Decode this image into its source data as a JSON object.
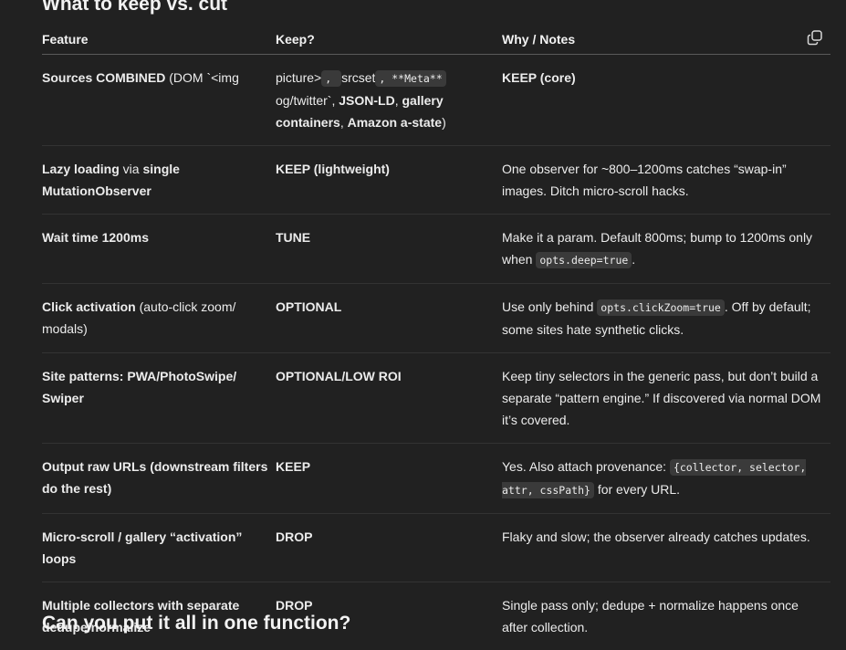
{
  "heading": "What to keep vs. cut",
  "next_heading": "Can you put it all in one function?",
  "table": {
    "headers": {
      "feature": "Feature",
      "keep": "Keep?",
      "why": "Why / Notes"
    },
    "rows": [
      {
        "feature": {
          "b1": "Sources COMBINED",
          "t1": " (DOM `<img"
        },
        "keep": {
          "t1": "picture>",
          "c1": ", ",
          "t2": "srcset",
          "c2": ", **Meta**",
          "t3": " og/twitter`, ",
          "b1": "JSON-LD",
          "t4": ", ",
          "b2": "gallery containers",
          "t5": ", ",
          "b3": "Amazon a-state",
          "t6": ")"
        },
        "why": {
          "b1": "KEEP (core)"
        }
      },
      {
        "feature": {
          "b1": "Lazy loading",
          "t1": " via ",
          "b2": "single MutationObserver"
        },
        "keep": {
          "b1": "KEEP (lightweight)"
        },
        "why": {
          "t1": "One observer for ~800–1200ms catches “swap-in” images. Ditch micro-scroll hacks."
        }
      },
      {
        "feature": {
          "b1": "Wait time 1200ms"
        },
        "keep": {
          "b1": "TUNE"
        },
        "why": {
          "t1": "Make it a param. Default 800ms; bump to 1200ms only when ",
          "c1": "opts.deep=true",
          "t2": "."
        }
      },
      {
        "feature": {
          "b1": "Click activation",
          "t1": " (auto-click zoom/ modals)"
        },
        "keep": {
          "b1": "OPTIONAL"
        },
        "why": {
          "t1": "Use only behind ",
          "c1": "opts.clickZoom=true",
          "t2": ". Off by default; some sites hate synthetic clicks."
        }
      },
      {
        "feature": {
          "b1": "Site patterns: PWA/PhotoSwipe/ Swiper"
        },
        "keep": {
          "b1": "OPTIONAL/LOW ROI"
        },
        "why": {
          "t1": "Keep tiny selectors in the generic pass, but don’t build a separate “pattern engine.” If discovered via normal DOM it’s covered."
        }
      },
      {
        "feature": {
          "b1": "Output raw URLs (downstream filters do the rest)"
        },
        "keep": {
          "b1": "KEEP"
        },
        "why": {
          "t1": "Yes. Also attach provenance: ",
          "c1": "{collector, selector, attr, cssPath}",
          "t2": " for every URL."
        }
      },
      {
        "feature": {
          "b1": "Micro-scroll / gallery “activation” loops"
        },
        "keep": {
          "b1": "DROP"
        },
        "why": {
          "t1": "Flaky and slow; the observer already catches updates."
        }
      },
      {
        "feature": {
          "b1": "Multiple collectors with separate dedupe/normalize"
        },
        "keep": {
          "b1": "DROP"
        },
        "why": {
          "t1": "Single pass only; dedupe + normalize happens once after collection."
        }
      }
    ]
  },
  "icons": {
    "copy": "copy-icon"
  },
  "colors": {
    "background": "#212121",
    "text": "#ececec",
    "code_bg": "#3a3a3a",
    "divider": "#333333"
  }
}
